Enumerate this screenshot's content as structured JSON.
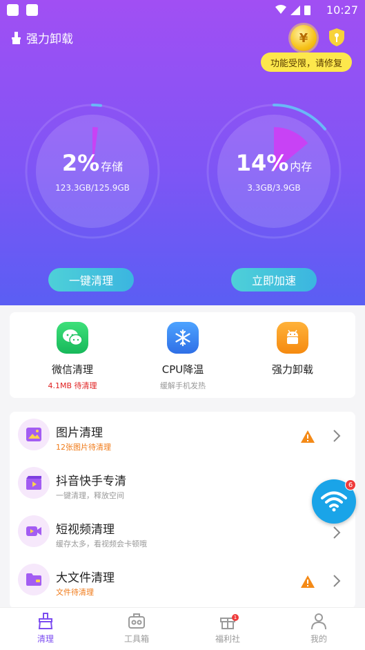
{
  "status_bar": {
    "time": "10:27"
  },
  "header": {
    "title": "强力卸载",
    "warning": "功能受限，请修复",
    "coin_symbol": "¥"
  },
  "gauges": [
    {
      "percent": "2%",
      "label": "存储",
      "usage": "123.3GB/125.9GB",
      "fraction": 0.02
    },
    {
      "percent": "14%",
      "label": "内存",
      "usage": "3.3GB/3.9GB",
      "fraction": 0.14
    }
  ],
  "hero_buttons": {
    "clean": "一键清理",
    "boost": "立即加速"
  },
  "quick_actions": [
    {
      "title": "微信清理",
      "sub": "4.1MB 待清理",
      "sub_color": "#e02020",
      "icon": "wechat-icon",
      "color": "#22c55e"
    },
    {
      "title": "CPU降温",
      "sub": "缓解手机发热",
      "sub_color": "#999999",
      "icon": "snowflake-icon",
      "color": "#3b82f6"
    },
    {
      "title": "强力卸载",
      "sub": "",
      "sub_color": "#999999",
      "icon": "android-icon",
      "color": "#f59e0b"
    }
  ],
  "list": [
    {
      "title": "图片清理",
      "sub": "12张图片待清理",
      "sub_color": "#f07a18",
      "warn": true,
      "icon": "image-icon"
    },
    {
      "title": "抖音快手专清",
      "sub": "一键清理，释放空间",
      "sub_color": "#999999",
      "warn": false,
      "icon": "video-clip-icon"
    },
    {
      "title": "短视频清理",
      "sub": "缓存太多，看视频会卡顿哦",
      "sub_color": "#999999",
      "warn": false,
      "icon": "video-camera-icon"
    },
    {
      "title": "大文件清理",
      "sub": "文件待清理",
      "sub_color": "#f07a18",
      "warn": true,
      "icon": "folder-icon"
    }
  ],
  "floating": {
    "badge": "6"
  },
  "tabs": [
    {
      "label": "清理",
      "active": true
    },
    {
      "label": "工具箱",
      "active": false
    },
    {
      "label": "福利社",
      "active": false,
      "badge": "1"
    },
    {
      "label": "我的",
      "active": false
    }
  ],
  "colors": {
    "accent": "#7c4cf0",
    "hero_top": "#a14ff3",
    "hero_bottom": "#5a5ef3",
    "button": "#3bb5e0"
  }
}
